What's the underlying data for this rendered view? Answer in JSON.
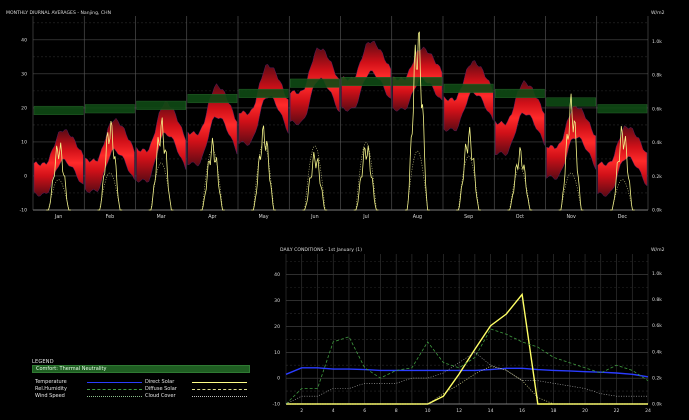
{
  "monthly": {
    "title": "MONTHLY DIURNAL AVERAGES - Nanjing, CHN",
    "right_unit": "W/m2",
    "y_ticks": [
      "-10",
      "0",
      "10",
      "20",
      "30",
      "40"
    ],
    "y2_ticks": [
      "0.0k",
      "0.2k",
      "0.4k",
      "0.6k",
      "0.8k",
      "1.0k"
    ],
    "months": [
      "Jan",
      "Feb",
      "Mar",
      "Apr",
      "May",
      "Jun",
      "Jul",
      "Aug",
      "Sep",
      "Oct",
      "Nov",
      "Dec"
    ]
  },
  "daily": {
    "title": "DAILY CONDITIONS - 1st January (1)",
    "right_unit": "W/m2",
    "y_ticks": [
      "-10",
      "0",
      "10",
      "20",
      "30",
      "40"
    ],
    "y2_ticks": [
      "0.0k",
      "0.2k",
      "0.4k",
      "0.6k",
      "0.8k",
      "1.0k"
    ],
    "x_ticks": [
      "2",
      "4",
      "6",
      "8",
      "10",
      "12",
      "14",
      "16",
      "18",
      "20",
      "22",
      "24"
    ]
  },
  "legend": {
    "title": "LEGEND",
    "comfort": "Comfort: Thermal Neutrality",
    "temperature": "Temperature",
    "rel_humidity": "Rel.Humidity",
    "wind_speed": "Wind Speed",
    "direct_solar": "Direct Solar",
    "diffuse_solar": "Diffuse Solar",
    "cloud_cover": "Cloud Cover"
  },
  "colors": {
    "background": "#000000",
    "band_outer": "#6a0a0e",
    "band_inner": "#ff1e1e",
    "comfort": "#1f5e22",
    "temperature": "#2a3cff",
    "solar": "#ffff88",
    "grid": "#3a3a3a"
  },
  "chart_data": [
    {
      "type": "area",
      "title": "MONTHLY DIURNAL AVERAGES - Nanjing, CHN",
      "categories": [
        "Jan",
        "Feb",
        "Mar",
        "Apr",
        "May",
        "Jun",
        "Jul",
        "Aug",
        "Sep",
        "Oct",
        "Nov",
        "Dec"
      ],
      "ylim": [
        -10,
        47
      ],
      "y2lim": [
        0,
        1150
      ],
      "comfort_band": [
        [
          18,
          20.5
        ],
        [
          18.5,
          21
        ],
        [
          19.5,
          22
        ],
        [
          21.5,
          24
        ],
        [
          23,
          25.5
        ],
        [
          26,
          28.5
        ],
        [
          26.5,
          29
        ],
        [
          26.5,
          29
        ],
        [
          24.5,
          27
        ],
        [
          23,
          25.5
        ],
        [
          20.5,
          23
        ],
        [
          18.5,
          21
        ]
      ],
      "temperature_min": [
        -1,
        0,
        3,
        8,
        14,
        20,
        24,
        24,
        18,
        11,
        4,
        -1
      ],
      "temperature_max": [
        9,
        12,
        17,
        22,
        28,
        33,
        35,
        33,
        29,
        23,
        16,
        10
      ],
      "direct_solar_peak": [
        430,
        560,
        560,
        430,
        520,
        360,
        420,
        1150,
        500,
        380,
        700,
        520
      ],
      "diffuse_solar_peak": [
        180,
        220,
        280,
        360,
        400,
        380,
        400,
        350,
        320,
        250,
        220,
        180
      ]
    },
    {
      "type": "line",
      "title": "DAILY CONDITIONS - 1st January (1)",
      "x": [
        1,
        2,
        3,
        4,
        5,
        6,
        7,
        8,
        9,
        10,
        11,
        12,
        13,
        14,
        15,
        16,
        17,
        18,
        19,
        20,
        21,
        22,
        23,
        24
      ],
      "xlim": [
        1,
        24
      ],
      "ylim": [
        -10,
        48
      ],
      "y2lim": [
        0,
        1150
      ],
      "series": [
        {
          "name": "Temperature",
          "axis": "left",
          "values": [
            1.5,
            4,
            4,
            3.5,
            3.5,
            3.3,
            3,
            3,
            3,
            3,
            3,
            3,
            3,
            3.3,
            3.8,
            3.8,
            3.3,
            3,
            2.8,
            2.5,
            2.3,
            2,
            1.5,
            0.5
          ]
        },
        {
          "name": "Direct Solar",
          "axis": "right",
          "values": [
            0,
            0,
            0,
            0,
            0,
            0,
            0,
            0,
            0,
            0,
            60,
            230,
            420,
            600,
            690,
            840,
            0,
            0,
            0,
            0,
            0,
            0,
            0,
            0
          ]
        },
        {
          "name": "Diffuse Solar",
          "axis": "right",
          "values": [
            0,
            0,
            0,
            0,
            0,
            0,
            0,
            0,
            0,
            0,
            80,
            150,
            230,
            290,
            260,
            180,
            50,
            0,
            0,
            0,
            0,
            0,
            0,
            0
          ]
        },
        {
          "name": "Rel.Humidity",
          "axis": "left",
          "values": [
            -10,
            -4,
            -4,
            14,
            16,
            4,
            0,
            3,
            4,
            14,
            6,
            4,
            8,
            19,
            17,
            14,
            12,
            8,
            6,
            4,
            2,
            5,
            3,
            -1
          ]
        },
        {
          "name": "Cloud Cover",
          "axis": "left",
          "values": [
            -10,
            -7,
            -7,
            -4,
            -4,
            -2,
            -2,
            -2,
            0,
            0,
            2,
            6,
            10,
            5,
            3,
            -1,
            -1,
            -2,
            -3,
            -4,
            -6,
            -7,
            -7,
            -7
          ]
        }
      ]
    }
  ]
}
